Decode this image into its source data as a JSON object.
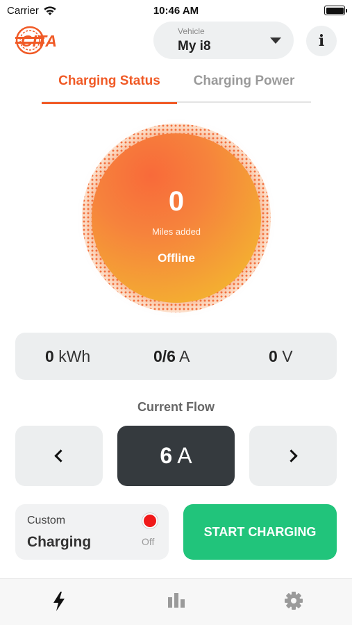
{
  "status_bar": {
    "carrier": "Carrier",
    "time": "10:46 AM"
  },
  "header": {
    "logo_text": "CITA",
    "vehicle_caption": "Vehicle",
    "vehicle_value": "My i8",
    "info_label": "i"
  },
  "tabs": [
    {
      "label": "Charging Status",
      "active": true
    },
    {
      "label": "Charging Power",
      "active": false
    }
  ],
  "gauge": {
    "miles": "0",
    "caption": "Miles added",
    "state": "Offline"
  },
  "metrics": {
    "energy_value": "0",
    "energy_unit": "kWh",
    "current_value": "0/6",
    "current_unit": "A",
    "voltage_value": "0",
    "voltage_unit": "V"
  },
  "current_flow": {
    "title": "Current Flow",
    "value": "6",
    "unit": "A"
  },
  "custom_charging": {
    "label": "Custom",
    "title": "Charging",
    "status": "Off"
  },
  "start_button": {
    "label": "START CHARGING"
  },
  "tabbar": [
    {
      "icon": "bolt-icon",
      "active": true
    },
    {
      "icon": "bar-chart-icon",
      "active": false
    },
    {
      "icon": "gear-icon",
      "active": false
    }
  ],
  "colors": {
    "accent": "#f05a26",
    "start_green": "#21c47b",
    "status_red": "#f01919",
    "flow_dark": "#353a3e"
  }
}
